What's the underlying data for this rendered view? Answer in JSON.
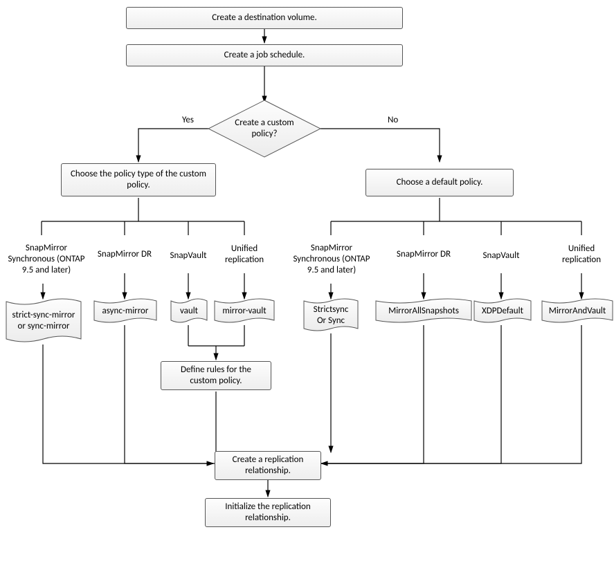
{
  "steps": {
    "create_dest": "Create a destination volume.",
    "create_job": "Create a job schedule.",
    "decision": "Create a custom policy?",
    "yes": "Yes",
    "no": "No",
    "choose_custom": "Choose the policy type of the custom policy.",
    "choose_default": "Choose a default policy.",
    "define_rules": "Define rules for the custom policy.",
    "create_rel": "Create a replication relationship.",
    "init_rel": "Initialize the replication relationship."
  },
  "custom_branches": {
    "sync": {
      "label": "SnapMirror Synchronous (ONTAP 9.5 and later)",
      "value": "strict-sync-mirror or sync-mirror"
    },
    "dr": {
      "label": "SnapMirror DR",
      "value": "async-mirror"
    },
    "vault": {
      "label": "SnapVault",
      "value": "vault"
    },
    "unif": {
      "label": "Unified replication",
      "value": "mirror-vault"
    }
  },
  "default_branches": {
    "sync": {
      "label": "SnapMirror Synchronous (ONTAP 9.5 and later)",
      "value": "Strictsync Or Sync"
    },
    "dr": {
      "label": "SnapMirror DR",
      "value": "MirrorAllSnapshots"
    },
    "vault": {
      "label": "SnapVault",
      "value": "XDPDefault"
    },
    "unif": {
      "label": "Unified replication",
      "value": "MirrorAndVault"
    }
  }
}
